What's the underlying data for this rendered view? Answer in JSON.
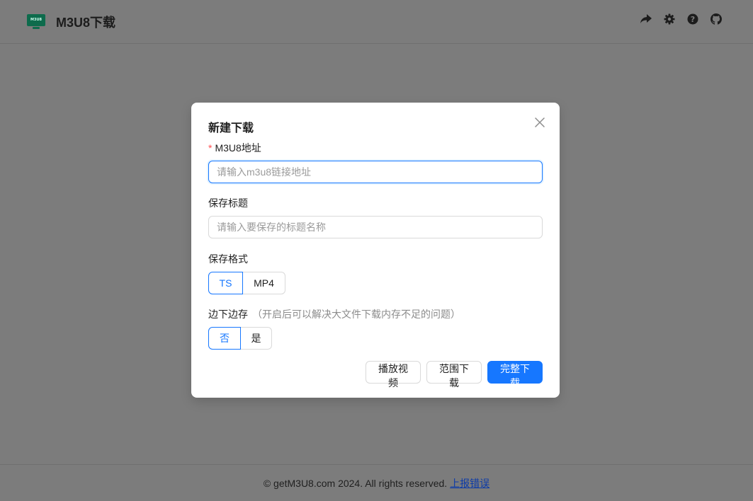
{
  "header": {
    "logo_text": "M3U8",
    "title": "M3U8下载",
    "icons": [
      "share-icon",
      "gear-icon",
      "help-icon",
      "github-icon"
    ]
  },
  "modal": {
    "title": "新建下载",
    "url_field": {
      "required_mark": "*",
      "label": "M3U8地址",
      "placeholder": "请输入m3u8链接地址",
      "value": ""
    },
    "title_field": {
      "label": "保存标题",
      "placeholder": "请输入要保存的标题名称",
      "value": ""
    },
    "format_field": {
      "label": "保存格式",
      "options": [
        "TS",
        "MP4"
      ],
      "selected": "TS"
    },
    "stream_field": {
      "label": "边下边存",
      "hint": "（开启后可以解决大文件下载内存不足的问题）",
      "options": [
        "否",
        "是"
      ],
      "selected": "否"
    },
    "actions": {
      "play": "播放视频",
      "range": "范围下载",
      "full": "完整下载"
    }
  },
  "footer": {
    "copyright": "© getM3U8.com 2024. All rights reserved.",
    "report_link": "上报错误"
  },
  "colors": {
    "primary": "#1677ff",
    "overlay": "#7c7c7c",
    "logo": "#0d6b4c",
    "required": "#ff4d4f"
  }
}
